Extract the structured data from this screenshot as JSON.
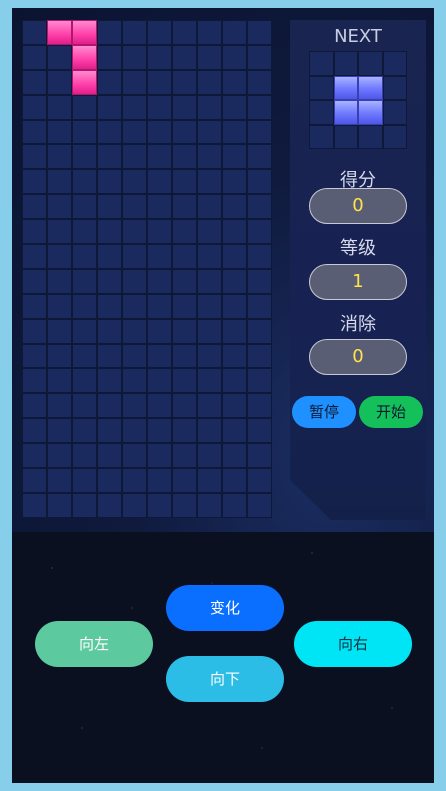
{
  "board": {
    "columns": 10,
    "rows": 20,
    "filled_cells": [
      [
        0,
        1
      ],
      [
        0,
        2
      ],
      [
        1,
        2
      ],
      [
        2,
        2
      ]
    ],
    "piece_color": "#ff3fa8"
  },
  "next": {
    "label": "NEXT",
    "columns": 4,
    "rows": 4,
    "filled_cells": [
      [
        1,
        1
      ],
      [
        1,
        2
      ],
      [
        2,
        1
      ],
      [
        2,
        2
      ]
    ],
    "piece_color": "#6e78ff"
  },
  "stats": {
    "score_label": "得分",
    "score_value": "0",
    "level_label": "等级",
    "level_value": "1",
    "lines_label": "消除",
    "lines_value": "0"
  },
  "buttons": {
    "pause": "暂停",
    "start": "开始",
    "rotate": "变化",
    "left": "向左",
    "right": "向右",
    "down": "向下"
  }
}
